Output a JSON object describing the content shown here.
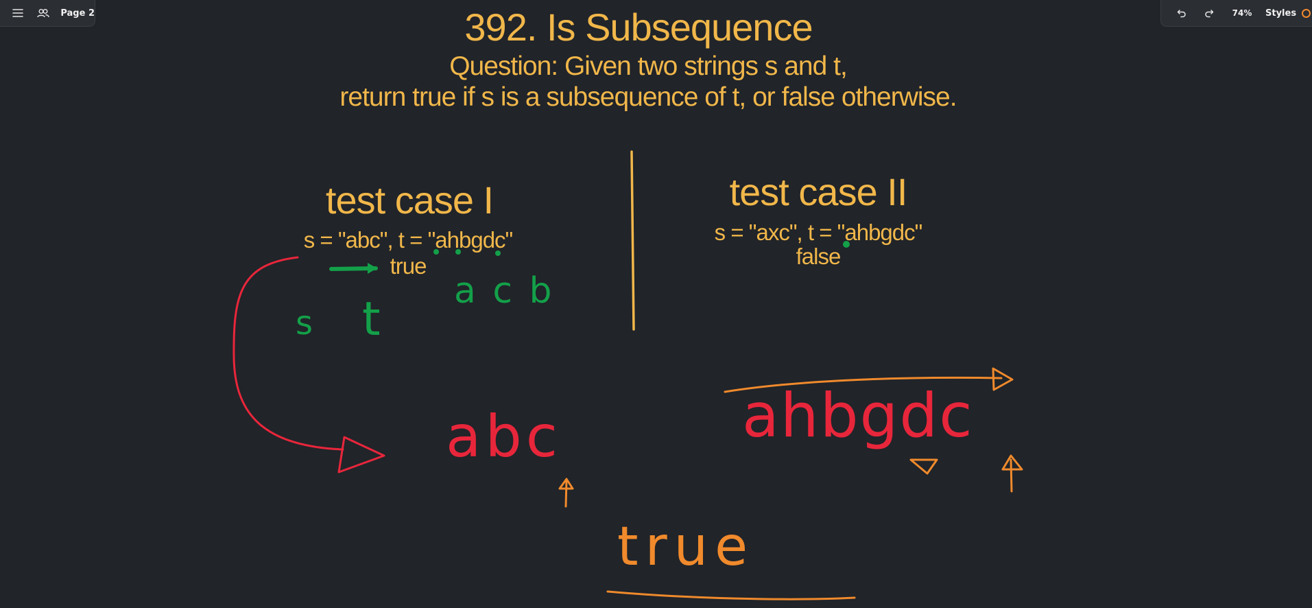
{
  "toolbar_left": {
    "page_label": "Page 2",
    "menu_icon": "hamburger-menu-icon",
    "collab_icon": "people-icon"
  },
  "toolbar_right": {
    "zoom_level": "74%",
    "styles_label": "Styles",
    "undo_icon": "undo-icon",
    "redo_icon": "redo-icon",
    "styles_color": "#f28a2e"
  },
  "board": {
    "title": "392. Is Subsequence",
    "question_line1": "Question: Given two strings s and t,",
    "question_line2": "return true if s is a subsequence of t, or false otherwise.",
    "case1": {
      "heading": "test case I",
      "input": "s = \"abc\", t = \"ahbgdc\"",
      "output": "true"
    },
    "case2": {
      "heading": "test case II",
      "input": "s = \"axc\", t = \"ahbgdc\"",
      "output": "false"
    },
    "handwriting": {
      "green_acb": "a c b",
      "green_s": "s",
      "green_t": "t",
      "red_abc": "abc",
      "red_ahbgdc": "ahbgdc",
      "orange_true": "true"
    }
  },
  "colors": {
    "background": "#212429",
    "text_yellow": "#f1b74a",
    "ink_green": "#13a049",
    "ink_red": "#e8263b",
    "ink_orange": "#f08a2c",
    "toolbar_bg": "#2b2e33"
  }
}
